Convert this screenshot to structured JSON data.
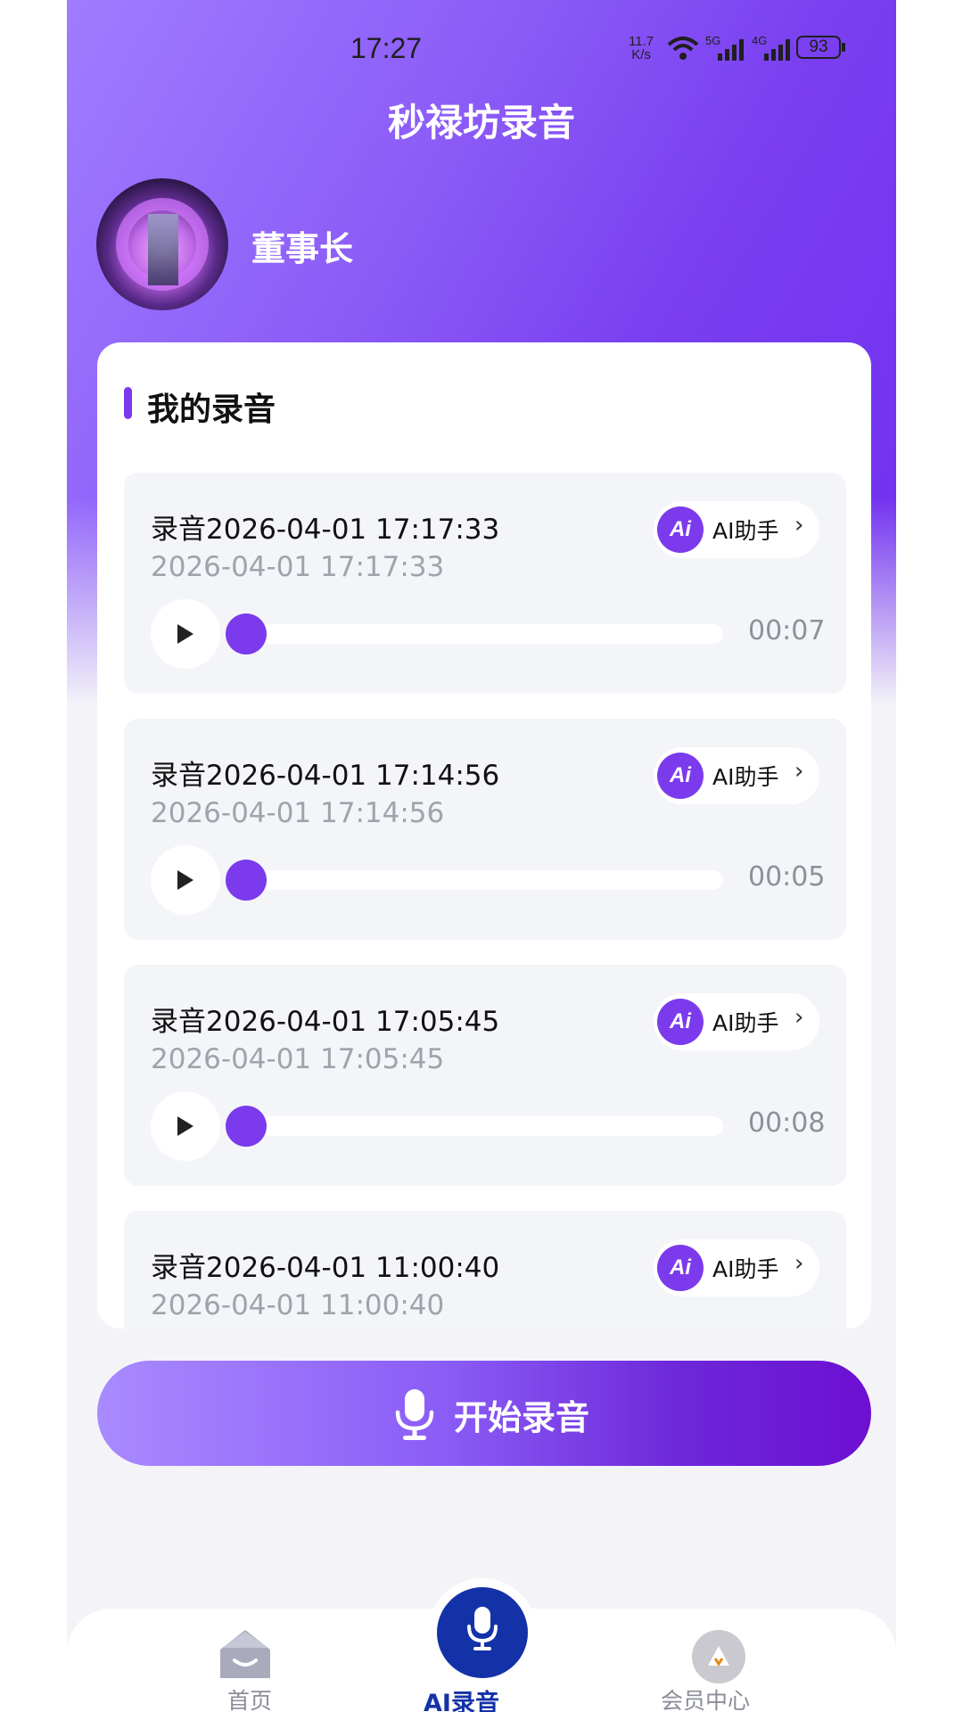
{
  "status_bar": {
    "time": "17:27",
    "net_speed_top": "11.7",
    "net_speed_unit": "K/s",
    "signal1": "5G",
    "signal2": "4G",
    "battery": "93"
  },
  "header": {
    "title": "秒禄坊录音",
    "username": "董事长"
  },
  "section": {
    "title": "我的录音"
  },
  "recordings": [
    {
      "title": "录音2026-04-01 17:17:33",
      "date": "2026-04-01 17:17:33",
      "duration": "00:07",
      "progress": 0
    },
    {
      "title": "录音2026-04-01 17:14:56",
      "date": "2026-04-01 17:14:56",
      "duration": "00:05",
      "progress": 0
    },
    {
      "title": "录音2026-04-01 17:05:45",
      "date": "2026-04-01 17:05:45",
      "duration": "00:08",
      "progress": 0
    },
    {
      "title": "录音2026-04-01 11:00:40",
      "date": "2026-04-01 11:00:40",
      "duration": "",
      "progress": 0
    }
  ],
  "ai_button": {
    "icon_text": "Ai",
    "label": "AI助手",
    "chevron": "›"
  },
  "start_button": {
    "label": "开始录音",
    "icon": "microphone-icon"
  },
  "tabbar": {
    "home": {
      "label": "首页",
      "icon": "home-icon"
    },
    "ai": {
      "label": "AI录音",
      "icon": "microphone-icon"
    },
    "vip": {
      "label": "会员中心",
      "icon": "vip-icon"
    }
  },
  "colors": {
    "accent": "#7c3aed",
    "tab_active": "#1432a8",
    "muted": "#a0a3ab"
  }
}
